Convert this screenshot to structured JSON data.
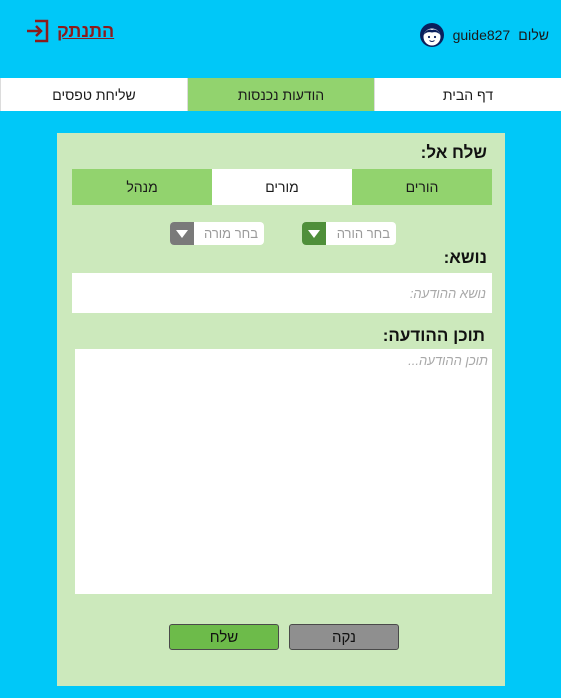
{
  "header": {
    "greeting_prefix": "שלום",
    "username": "guide827",
    "logout_label": "התנתק"
  },
  "nav": {
    "tabs": [
      {
        "label": "דף הבית",
        "active": false
      },
      {
        "label": "הודעות נכנסות",
        "active": true
      },
      {
        "label": "שליחת טפסים",
        "active": false
      }
    ]
  },
  "compose": {
    "send_to_label": "שלח אל:",
    "recipient_tabs": [
      {
        "label": "הורים",
        "active": false
      },
      {
        "label": "מורים",
        "active": true
      },
      {
        "label": "מנהל",
        "active": false
      }
    ],
    "parent_select_placeholder": "בחר הורה",
    "teacher_select_placeholder": "בחר מורה",
    "subject_label": "נושא:",
    "subject_placeholder": "נושא ההודעה:",
    "content_label": "תוכן ההודעה:",
    "content_placeholder": "תוכן ההודעה...",
    "send_label": "שלח",
    "clear_label": "נקה"
  },
  "colors": {
    "background": "#00c8f8",
    "panel": "#cce9bc",
    "tab_green": "#92d36e",
    "send_button": "#6dbb4a",
    "clear_button": "#8f8f8f",
    "logout": "#8b1c1c",
    "parent_select_arrow": "#4f8f3a",
    "teacher_select_arrow": "#7a7a7a"
  }
}
